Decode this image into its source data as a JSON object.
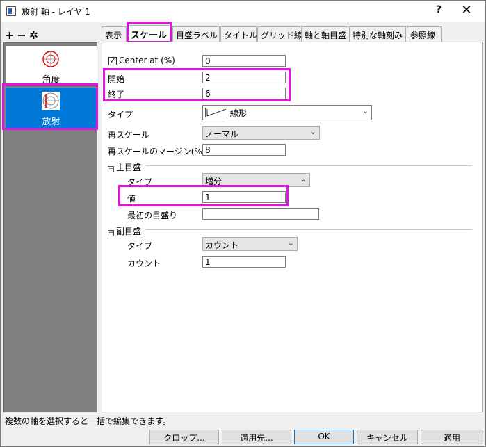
{
  "window": {
    "title": "放射 軸 - レイヤ 1",
    "help_label": "?",
    "close_label": "✕"
  },
  "toolbar": {
    "add_label": "+",
    "remove_label": "−",
    "settings_label": "✲"
  },
  "axes_list": {
    "items": [
      {
        "label": "角度",
        "icon": "angular-axis-icon",
        "selected": false
      },
      {
        "label": "放射",
        "icon": "radial-axis-icon",
        "selected": true
      }
    ]
  },
  "tabs": [
    {
      "label": "表示",
      "active": false
    },
    {
      "label": "スケール",
      "active": true
    },
    {
      "label": "目盛ラベル",
      "active": false
    },
    {
      "label": "タイトル",
      "active": false
    },
    {
      "label": "グリッド線",
      "active": false
    },
    {
      "label": "軸と軸目盛",
      "active": false
    },
    {
      "label": "特別な軸刻み",
      "active": false
    },
    {
      "label": "参照線",
      "active": false
    }
  ],
  "scale": {
    "center_at": {
      "label": "Center at (%)",
      "checked": true,
      "value": "0"
    },
    "start": {
      "label": "開始",
      "value": "2"
    },
    "end": {
      "label": "終了",
      "value": "6"
    },
    "type": {
      "label": "タイプ",
      "value": "線形"
    },
    "rescale": {
      "label": "再スケール",
      "value": "ノーマル"
    },
    "rescale_margin": {
      "label": "再スケールのマージン(%)",
      "value": "8"
    }
  },
  "major_ticks": {
    "label": "主目盛",
    "collapse_glyph": "−",
    "type": {
      "label": "タイプ",
      "value": "増分"
    },
    "value": {
      "label": "値",
      "value": "1"
    },
    "first_tick": {
      "label": "最初の目盛り",
      "value": ""
    }
  },
  "minor_ticks": {
    "label": "副目盛",
    "collapse_glyph": "−",
    "type": {
      "label": "タイプ",
      "value": "カウント"
    },
    "count": {
      "label": "カウント",
      "value": "1"
    }
  },
  "status": {
    "text": "複数の軸を選択すると一括で編集できます。"
  },
  "buttons": {
    "crop": "クロップ...",
    "apply_to": "適用先...",
    "ok": "OK",
    "cancel": "キャンセル",
    "apply": "適用"
  },
  "colors": {
    "highlight": "#e014e0",
    "selection": "#0078d7"
  }
}
